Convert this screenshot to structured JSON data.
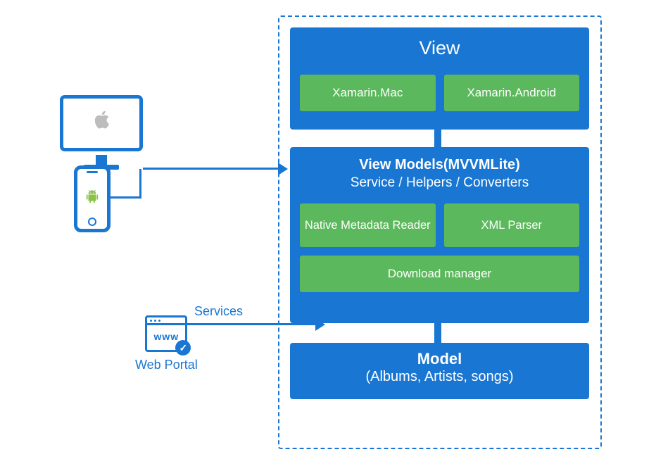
{
  "diagram": {
    "view": {
      "title": "View",
      "platforms": [
        "Xamarin.Mac",
        "Xamarin.Android"
      ]
    },
    "viewmodels": {
      "title": "View Models(MVVMLite)",
      "subtitle": "Service / Helpers / Converters",
      "components": {
        "metadata_reader": "Native Metadata Reader",
        "xml_parser": "XML Parser",
        "download_manager": "Download manager"
      }
    },
    "model": {
      "title": "Model",
      "subtitle": "(Albums, Artists, songs)"
    },
    "left": {
      "portal_label": "Web Portal",
      "portal_www": "www",
      "services_label": "Services"
    }
  },
  "colors": {
    "blue": "#1976d2",
    "green": "#5cb85c",
    "icon_gray": "#bdbdbd"
  }
}
